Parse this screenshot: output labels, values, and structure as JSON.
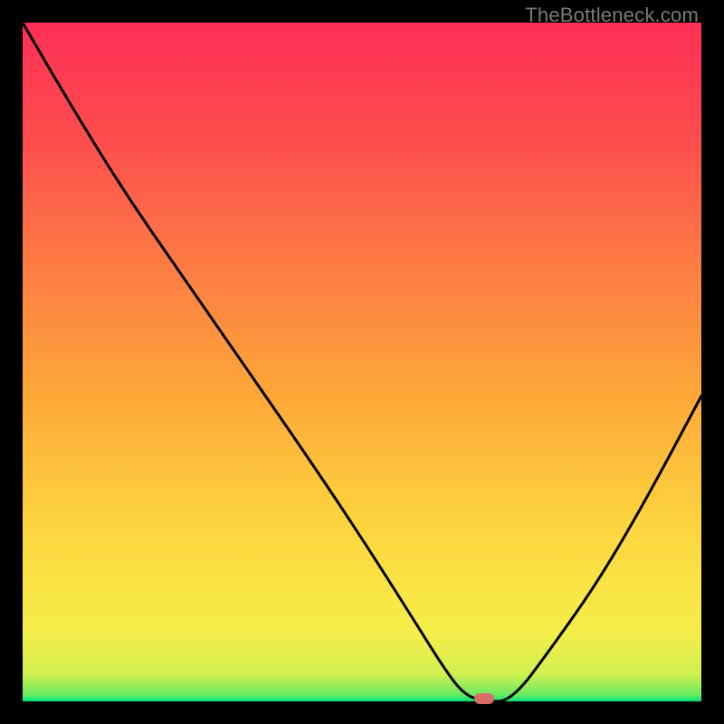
{
  "watermark": "TheBottleneck.com",
  "chart_data": {
    "type": "line",
    "title": "",
    "xlabel": "",
    "ylabel": "",
    "xlim": [
      0,
      100
    ],
    "ylim": [
      0,
      100
    ],
    "grid": false,
    "legend": false,
    "series": [
      {
        "name": "bottleneck-curve",
        "x": [
          0,
          7,
          15,
          24,
          33,
          42,
          50,
          57,
          62,
          65,
          68,
          72,
          78,
          85,
          92,
          100
        ],
        "y": [
          100,
          88,
          75,
          62,
          49,
          36,
          24,
          13,
          5,
          1,
          0,
          0,
          8,
          18,
          30,
          45
        ]
      }
    ],
    "marker": {
      "x": 68,
      "y": 0,
      "color": "#d96b6b"
    },
    "background_gradient": {
      "stops": [
        {
          "pos": 0,
          "color": "#00e676"
        },
        {
          "pos": 1,
          "color": "#6bea60"
        },
        {
          "pos": 4,
          "color": "#d0f050"
        },
        {
          "pos": 10,
          "color": "#f5ee4a"
        },
        {
          "pos": 25,
          "color": "#fdd73f"
        },
        {
          "pos": 45,
          "color": "#fda839"
        },
        {
          "pos": 65,
          "color": "#fd7a45"
        },
        {
          "pos": 82,
          "color": "#fd4f4e"
        },
        {
          "pos": 100,
          "color": "#fd2f55"
        }
      ]
    }
  }
}
